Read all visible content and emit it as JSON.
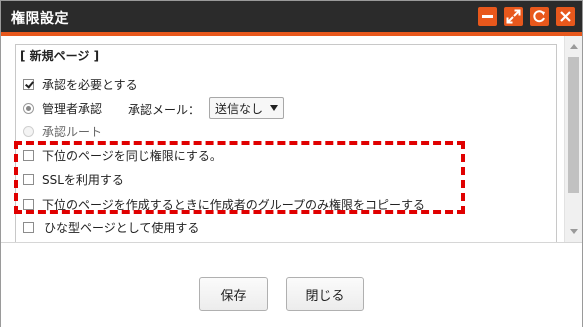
{
  "dialog": {
    "title": "権限設定",
    "section_label": "[ 新規ページ ]"
  },
  "options": {
    "require_approval": {
      "label": "承認を必要とする",
      "checked": true
    },
    "admin_approval": {
      "label": "管理者承認",
      "selected": true
    },
    "approval_mail_label": "承認メール：",
    "approval_mail_value": "送信なし",
    "approval_route": {
      "label": "承認ルート",
      "selected": false
    },
    "same_permission": {
      "label": "下位のページを同じ権限にする。",
      "checked": false
    },
    "use_ssl": {
      "label": "SSLを利用する",
      "checked": false
    },
    "copy_group_permission": {
      "label": "下位のページを作成するときに作成者のグループのみ権限をコピーする",
      "checked": false
    },
    "use_as_template": {
      "label": "ひな型ページとして使用する",
      "checked": false
    }
  },
  "footer": {
    "save_label": "保存",
    "close_label": "閉じる"
  },
  "colors": {
    "titlebar": "#2b2b2b",
    "accent": "#e8581c",
    "highlight_dash": "#e00000"
  },
  "icons": [
    "minimize-icon",
    "maximize-icon",
    "refresh-icon",
    "close-icon"
  ]
}
